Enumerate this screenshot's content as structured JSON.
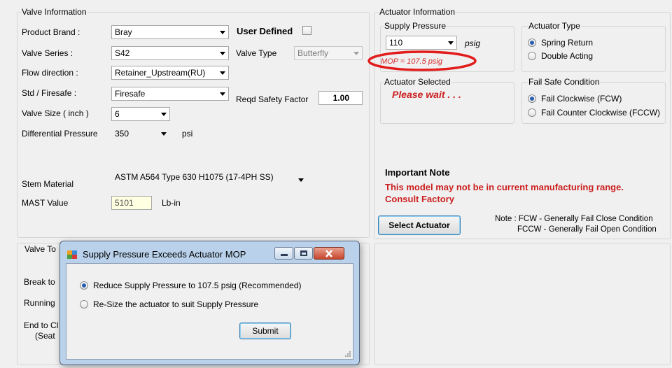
{
  "valve_info": {
    "title": "Valve Information",
    "product_brand": {
      "label": "Product Brand :",
      "value": "Bray"
    },
    "valve_series": {
      "label": "Valve Series   :",
      "value": "S42"
    },
    "flow_direction": {
      "label": "Flow direction :",
      "value": "Retainer_Upstream(RU)"
    },
    "std_firesafe": {
      "label": "Std / Firesafe :",
      "value": "Firesafe"
    },
    "valve_size": {
      "label": "Valve Size ( inch )",
      "value": "6"
    },
    "differential_pressure": {
      "label": "Differential Pressure",
      "value": "350",
      "unit": "psi"
    },
    "user_defined": {
      "label": "User Defined",
      "checked": false
    },
    "valve_type": {
      "label": "Valve Type",
      "value": "Butterfly"
    },
    "reqd_safety_factor": {
      "label": "Reqd Safety Factor",
      "value": "1.00"
    },
    "stem_material": {
      "label": "Stem Material",
      "value": "ASTM A564 Type 630 H1075 (17-4PH SS)"
    },
    "mast_value": {
      "label": "MAST Value",
      "value": "5101",
      "unit": "Lb-in"
    }
  },
  "valve_torque": {
    "title": "Valve To",
    "break_label": "Break to",
    "running_label": "Running",
    "end_label": "End to Cl",
    "seat_label": "(Seat"
  },
  "actuator_info": {
    "title": "Actuator Information",
    "supply_pressure": {
      "title": "Supply Pressure",
      "value": "110",
      "unit": "psig",
      "mop_text": "MOP = 107.5 psig"
    },
    "actuator_type": {
      "title": "Actuator Type",
      "options": [
        "Spring Return",
        "Double Acting"
      ],
      "selected": 0
    },
    "actuator_selected": {
      "title": "Actuator Selected",
      "value": "Please wait . . ."
    },
    "fail_safe": {
      "title": "Fail Safe Condition",
      "options": [
        "Fail Clockwise (FCW)",
        "Fail Counter Clockwise (FCCW)"
      ],
      "selected": 0
    },
    "important_note": {
      "title": "Important Note",
      "line1": "This model may not be in current manufacturing range.",
      "line2": "Consult Factory"
    },
    "select_button": "Select Actuator",
    "note_line1": "Note : FCW  - Generally Fail Close Condition",
    "note_line2": "FCCW - Generally Fail Open Condition"
  },
  "dialog": {
    "title": "Supply Pressure Exceeds Actuator MOP",
    "options": [
      "Reduce Supply Pressure to 107.5 psig (Recommended)",
      "Re-Size the actuator to suit Supply Pressure"
    ],
    "selected": 0,
    "submit_label": "Submit"
  },
  "colors": {
    "accent_red": "#cc2020",
    "highlight_circle": "#e21b1b",
    "mast_bg": "#ffffe1"
  }
}
